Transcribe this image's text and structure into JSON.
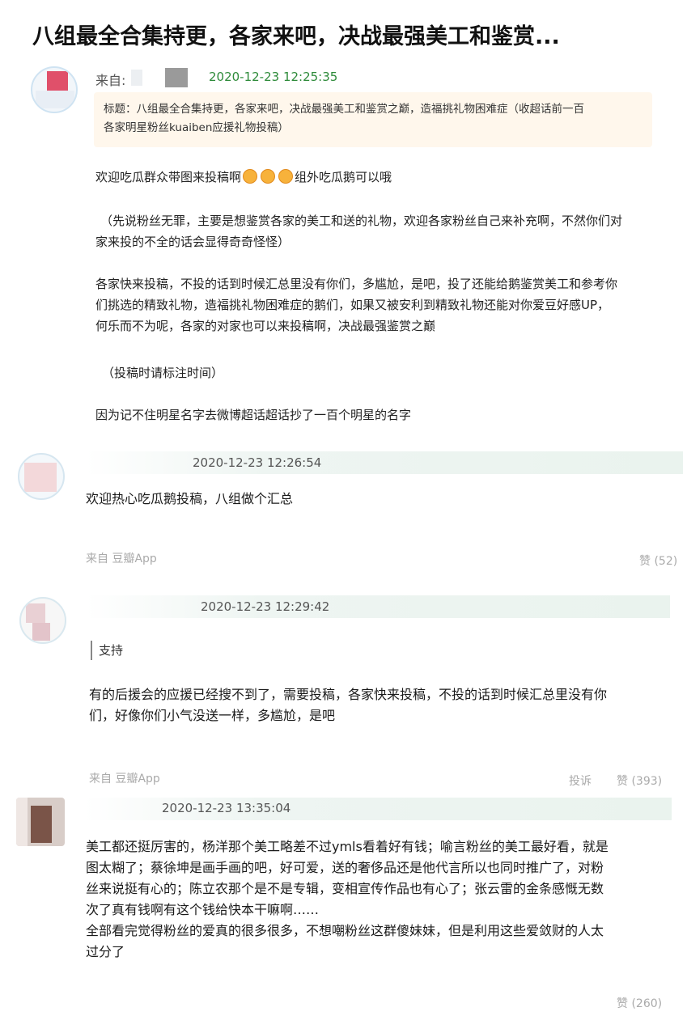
{
  "post": {
    "title": "八组最全合集持更，各家来吧，决战最强美工和鉴赏...",
    "from_label": "来自:",
    "time": "2020-12-23 12:25:35",
    "subject_line1": "标题：八组最全合集持更，各家来吧，决战最强美工和鉴赏之巅，造福挑礼物困难症（收超话前一百",
    "subject_line2": "各家明星粉丝kuaiben应援礼物投稿）",
    "p1_before": "欢迎吃瓜群众带图来投稿啊",
    "p1_after": "组外吃瓜鹅可以哦",
    "p2_line1": "（先说粉丝无罪，主要是想鉴赏各家的美工和送的礼物，欢迎各家粉丝自己来补充啊，不然你们对",
    "p2_line2": "家来投的不全的话会显得奇奇怪怪）",
    "p3_line1": "各家快来投稿，不投的话到时候汇总里没有你们，多尴尬，是吧，投了还能给鹅鉴赏美工和参考你",
    "p3_line2": "们挑选的精致礼物，造福挑礼物困难症的鹅们，如果又被安利到精致礼物还能对你爱豆好感UP，",
    "p3_line3": "何乐而不为呢，各家的对家也可以来投稿啊，决战最强鉴赏之巅",
    "p4": "（投稿时请标注时间）",
    "p5": "因为记不住明星名字去微博超话超话抄了一百个明星的名字"
  },
  "replies": [
    {
      "time": "2020-12-23 12:26:54",
      "text": "欢迎热心吃瓜鹅投稿，八组做个汇总",
      "source": "来自 豆瓣App",
      "likes": "赞 (52)"
    },
    {
      "time": "2020-12-23 12:29:42",
      "quote": "支持",
      "text_line1": "有的后援会的应援已经搜不到了，需要投稿，各家快来投稿，不投的话到时候汇总里没有你",
      "text_line2": "们，好像你们小气没送一样，多尴尬，是吧",
      "source": "来自 豆瓣App",
      "report": "投诉",
      "likes": "赞 (393)"
    },
    {
      "time": "2020-12-23 13:35:04",
      "text_line1": "美工都还挺厉害的，杨洋那个美工略差不过ymls看着好有钱；喻言粉丝的美工最好看，就是",
      "text_line2": "图太糊了；蔡徐坤是画手画的吧，好可爱，送的奢侈品还是他代言所以也同时推广了，对粉",
      "text_line3": "丝来说挺有心的；陈立农那个是不是专辑，变相宣传作品也有心了；张云雷的金条感慨无数",
      "text_line4": "次了真有钱啊有这个钱给快本干嘛啊……",
      "text_line5": "全部看完觉得粉丝的爱真的很多很多，不想嘲粉丝这群傻妹妹，但是利用这些爱敛财的人太",
      "text_line6": "过分了",
      "likes": "赞 (260)"
    }
  ],
  "colors": {
    "time_green": "#2e8b3a",
    "subject_bg": "#fff7ec",
    "reply_bar": "#eaf3ee"
  },
  "icons": {
    "emoji": "smiling-face-emoji"
  }
}
